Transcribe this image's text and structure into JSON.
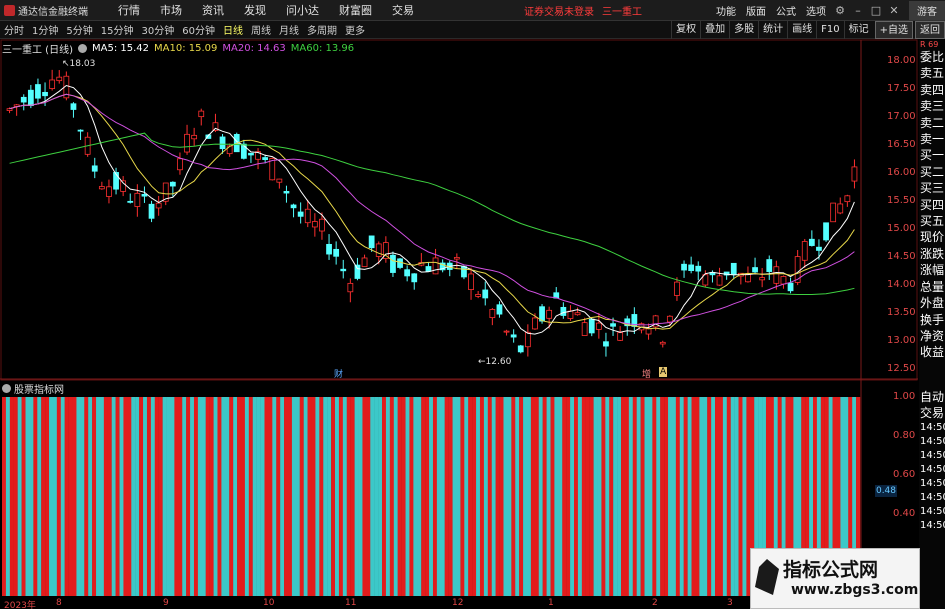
{
  "app": {
    "title": "通达信金融终端"
  },
  "menu": {
    "items": [
      "行情",
      "市场",
      "资讯",
      "发现",
      "问小达",
      "财富圈",
      "交易"
    ],
    "notice": "证券交易未登录",
    "stock_name": "三一重工",
    "right_items": [
      "功能",
      "版面",
      "公式",
      "选项"
    ],
    "guest": "游客"
  },
  "toolbar": {
    "periods": [
      "分时",
      "1分钟",
      "5分钟",
      "15分钟",
      "30分钟",
      "60分钟",
      "日线",
      "周线",
      "月线",
      "多周期",
      "更多"
    ],
    "active_period": "日线",
    "tools": [
      "复权",
      "叠加",
      "多股",
      "统计",
      "画线",
      "F10",
      "标记",
      "+自选",
      "返回"
    ]
  },
  "legend": {
    "title": "三一重工 (日线)",
    "ma": [
      {
        "label": "MA5: 15.42",
        "color": "#ffffff"
      },
      {
        "label": "MA10: 15.09",
        "color": "#e8d84a"
      },
      {
        "label": "MA20: 14.63",
        "color": "#d050e0"
      },
      {
        "label": "MA60: 13.96",
        "color": "#3ed040"
      }
    ]
  },
  "indicator": {
    "title": "股票指标网"
  },
  "price_axis": {
    "labels": [
      "18.00",
      "17.50",
      "17.00",
      "16.50",
      "16.00",
      "15.50",
      "15.00",
      "14.50",
      "14.00",
      "13.50",
      "13.00",
      "12.50"
    ]
  },
  "indicator_axis": {
    "labels": [
      "1.00",
      "0.80",
      "0.60",
      "0.40"
    ],
    "highlight": "0.48"
  },
  "annotations": {
    "high": "18.03",
    "low": "12.60",
    "events": [
      "财",
      "增",
      "A"
    ]
  },
  "dates": [
    "2023年",
    "8",
    "9",
    "10",
    "11",
    "12",
    "1",
    "2",
    "3"
  ],
  "side_panel": {
    "header": "R 69",
    "items": [
      "委比",
      "卖五",
      "卖四",
      "卖三",
      "卖二",
      "卖一",
      "买一",
      "买二",
      "买三",
      "买四",
      "买五",
      "现价",
      "涨跌",
      "涨幅",
      "总量",
      "外盘",
      "换手",
      "净资",
      "收益"
    ],
    "bottom": [
      "自动",
      "交易",
      "14:50",
      "14:50",
      "14:50",
      "14:50",
      "14:50",
      "14:50",
      "14:50",
      "14:50"
    ]
  },
  "watermark": {
    "text": "指标公式网",
    "url": "www.zbgs3.com"
  },
  "colors": {
    "up": "#ff3030",
    "down": "#54ffff",
    "indicator_red": "#e21c1c",
    "indicator_cyan": "#3cc8c8",
    "ma5": "#ffffff",
    "ma10": "#e8d84a",
    "ma20": "#d050e0",
    "ma60": "#3ed040"
  },
  "chart_data": {
    "type": "candlestick",
    "title": "三一重工 (日线)",
    "ylim": [
      12.3,
      18.3
    ],
    "x": [
      "2023年",
      "8",
      "9",
      "10",
      "11",
      "12",
      "1",
      "2",
      "3"
    ],
    "price_trend": [
      17.2,
      17.3,
      17.4,
      17.5,
      17.6,
      17.7,
      17.8,
      17.8,
      17.6,
      17.3,
      16.9,
      16.5,
      16.1,
      15.9,
      15.8,
      15.8,
      15.7,
      15.6,
      15.5,
      15.4,
      15.4,
      15.5,
      15.6,
      15.8,
      16.1,
      16.6,
      16.9,
      17.0,
      16.9,
      16.8,
      16.7,
      16.6,
      16.6,
      16.5,
      16.4,
      16.3,
      16.2,
      16.1,
      16.0,
      15.7,
      15.4,
      15.2,
      15.1,
      15.0,
      14.9,
      14.7,
      14.5,
      14.2,
      14.0,
      14.2,
      14.4,
      14.6,
      14.6,
      14.5,
      14.3,
      14.2,
      14.2,
      14.2,
      14.3,
      14.3,
      14.3,
      14.3,
      14.2,
      14.2,
      14.1,
      14.0,
      13.8,
      13.6,
      13.4,
      13.3,
      13.0,
      12.8,
      12.7,
      12.8,
      13.1,
      13.3,
      13.5,
      13.6,
      13.5,
      13.4,
      13.3,
      13.2,
      13.2,
      13.1,
      13.0,
      13.0,
      13.1,
      13.2,
      13.3,
      13.3,
      13.2,
      13.1,
      13.0,
      13.4,
      13.8,
      14.1,
      14.3,
      14.2,
      14.1,
      14.0,
      14.1,
      14.2,
      14.2,
      14.1,
      14.0,
      14.0,
      14.1,
      14.2,
      14.1,
      14.0,
      14.0,
      14.2,
      14.5,
      14.7,
      14.8,
      15.0,
      15.2,
      15.4,
      15.6,
      16.1
    ],
    "indicator_pattern": [
      1,
      0,
      1,
      1,
      0,
      1,
      0,
      0,
      1,
      0,
      1,
      1,
      0,
      0,
      1,
      0,
      1,
      1,
      1,
      0,
      0,
      1,
      0,
      1,
      0,
      0,
      1,
      1,
      0,
      1,
      0,
      1,
      1,
      0,
      0,
      1,
      0,
      1,
      0,
      1,
      1,
      0,
      0,
      0,
      1,
      1,
      0,
      1,
      0,
      1,
      0,
      0,
      1,
      1,
      0,
      1,
      0,
      0,
      1,
      0,
      1,
      1,
      0,
      1,
      0,
      0,
      0,
      1,
      1,
      0,
      1,
      0,
      1,
      1,
      0,
      0,
      1,
      0,
      1,
      1,
      0,
      1,
      0,
      0,
      1,
      0,
      1,
      0,
      1,
      1,
      0,
      0,
      1,
      1,
      0,
      0,
      0,
      1,
      0,
      1,
      0,
      1,
      1,
      0,
      1,
      0,
      0,
      1,
      1,
      0,
      1,
      0,
      0,
      1,
      1,
      0,
      0,
      1,
      0,
      1,
      1,
      0,
      1,
      0,
      1,
      0,
      1,
      1,
      0,
      0,
      1,
      0,
      1,
      0,
      0,
      1,
      1,
      0,
      1,
      0,
      1,
      0,
      0,
      1,
      1,
      0,
      1,
      0,
      1,
      1,
      1,
      0,
      0,
      1,
      0,
      1,
      0,
      0,
      1,
      1,
      0,
      1,
      0,
      1,
      0,
      0,
      1,
      0,
      1,
      1,
      0,
      0,
      1,
      0,
      1,
      0,
      1,
      1,
      0,
      0,
      1,
      0,
      1,
      1,
      0,
      1,
      0,
      0,
      1,
      0,
      1,
      1,
      0,
      0,
      0,
      1,
      1,
      0,
      1,
      0,
      1,
      1,
      0,
      0,
      1,
      1,
      0,
      1,
      0,
      1,
      1,
      0,
      1,
      1,
      0,
      0,
      1,
      0,
      1
    ]
  }
}
